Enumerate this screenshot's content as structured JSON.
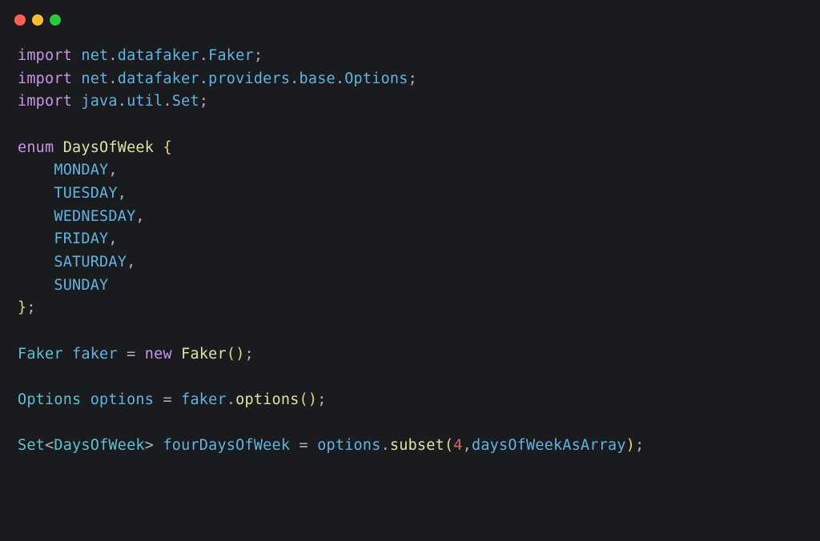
{
  "titlebar": {
    "buttons": [
      "close",
      "minimize",
      "zoom"
    ]
  },
  "code": {
    "line1": {
      "kw": "import",
      "p1": " net",
      "d1": ".",
      "p2": "datafaker",
      "d2": ".",
      "p3": "Faker",
      "semi": ";"
    },
    "line2": {
      "kw": "import",
      "p1": " net",
      "d1": ".",
      "p2": "datafaker",
      "d2": ".",
      "p3": "providers",
      "d3": ".",
      "p4": "base",
      "d4": ".",
      "p5": "Options",
      "semi": ";"
    },
    "line3": {
      "kw": "import",
      "p1": " java",
      "d1": ".",
      "p2": "util",
      "d2": ".",
      "p3": "Set",
      "semi": ";"
    },
    "line5": {
      "kw": "enum",
      "sp": " ",
      "name": "DaysOfWeek",
      "sp2": " ",
      "brace": "{"
    },
    "line6": {
      "indent": "    ",
      "val": "MONDAY",
      "comma": ","
    },
    "line7": {
      "indent": "    ",
      "val": "TUESDAY",
      "comma": ","
    },
    "line8": {
      "indent": "    ",
      "val": "WEDNESDAY",
      "comma": ","
    },
    "line9": {
      "indent": "    ",
      "val": "FRIDAY",
      "comma": ","
    },
    "line10": {
      "indent": "    ",
      "val": "SATURDAY",
      "comma": ","
    },
    "line11": {
      "indent": "    ",
      "val": "SUNDAY"
    },
    "line12": {
      "brace": "}",
      "semi": ";"
    },
    "line14": {
      "type": "Faker",
      "sp": " ",
      "var": "faker",
      "sp2": " ",
      "eq": "=",
      "sp3": " ",
      "kw": "new",
      "sp4": " ",
      "ctor": "Faker",
      "lp": "(",
      "rp": ")",
      "semi": ";"
    },
    "line16": {
      "type": "Options",
      "sp": " ",
      "var": "options",
      "sp2": " ",
      "eq": "=",
      "sp3": " ",
      "obj": "faker",
      "dot": ".",
      "method": "options",
      "lp": "(",
      "rp": ")",
      "semi": ";"
    },
    "line18": {
      "type": "Set",
      "lt": "<",
      "gen": "DaysOfWeek",
      "gt": ">",
      "sp": " ",
      "var": "fourDaysOfWeek",
      "sp2": " ",
      "eq": "=",
      "sp3": " ",
      "obj": "options",
      "dot": ".",
      "method": "subset",
      "lp": "(",
      "num": "4",
      "comma": ",",
      "arg": "daysOfWeekAsArray",
      "rp": ")",
      "semi": ";"
    }
  }
}
